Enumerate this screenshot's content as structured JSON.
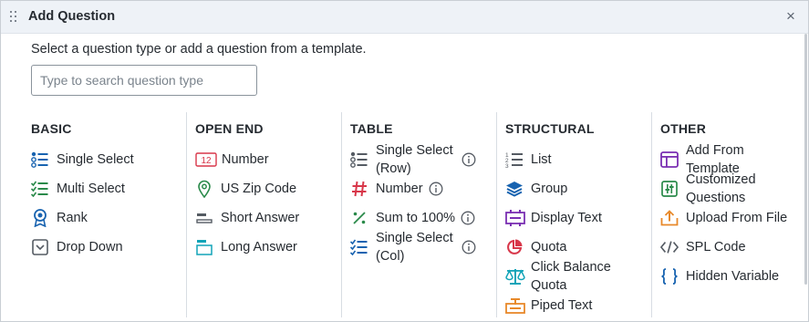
{
  "dialog": {
    "title": "Add Question",
    "close_label": "×",
    "subtitle": "Select a question type or add a question from a template.",
    "search_placeholder": "Type to search question type"
  },
  "colors": {
    "blue": "#1863b0",
    "green": "#2a8a4a",
    "red": "#d8374a",
    "teal": "#12a4b8",
    "purple": "#7a2fb2",
    "orange": "#e8892a",
    "grey": "#555b63"
  },
  "columns": [
    {
      "heading": "BASIC",
      "items": [
        {
          "label": "Single Select",
          "icon": "single-select-icon"
        },
        {
          "label": "Multi Select",
          "icon": "multi-select-icon"
        },
        {
          "label": "Rank",
          "icon": "rank-icon"
        },
        {
          "label": "Drop Down",
          "icon": "dropdown-icon"
        }
      ]
    },
    {
      "heading": "OPEN END",
      "items": [
        {
          "label": "Number",
          "icon": "number-icon",
          "icon_text": "12"
        },
        {
          "label": "US Zip Code",
          "icon": "location-pin-icon"
        },
        {
          "label": "Short Answer",
          "icon": "short-answer-icon"
        },
        {
          "label": "Long Answer",
          "icon": "long-answer-icon"
        }
      ]
    },
    {
      "heading": "TABLE",
      "items": [
        {
          "label": "Single Select (Row)",
          "icon": "table-single-select-icon",
          "info": true
        },
        {
          "label": "Number",
          "icon": "hash-icon",
          "info": true
        },
        {
          "label": "Sum to 100%",
          "icon": "percent-icon",
          "info": true
        },
        {
          "label": "Single Select (Col)",
          "icon": "table-multi-select-icon",
          "info": true
        }
      ]
    },
    {
      "heading": "STRUCTURAL",
      "items": [
        {
          "label": "List",
          "icon": "numbered-list-icon"
        },
        {
          "label": "Group",
          "icon": "layers-icon"
        },
        {
          "label": "Display Text",
          "icon": "display-text-icon"
        },
        {
          "label": "Quota",
          "icon": "pie-chart-icon"
        },
        {
          "label": "Click Balance Quota",
          "icon": "balance-scale-icon"
        },
        {
          "label": "Piped Text",
          "icon": "piped-text-icon"
        }
      ]
    },
    {
      "heading": "OTHER",
      "items": [
        {
          "label": "Add From Template",
          "icon": "template-icon"
        },
        {
          "label": "Customized Questions",
          "icon": "customized-icon"
        },
        {
          "label": "Upload From File",
          "icon": "upload-icon"
        },
        {
          "label": "SPL Code",
          "icon": "code-icon"
        },
        {
          "label": "Hidden Variable",
          "icon": "braces-icon"
        }
      ]
    }
  ]
}
